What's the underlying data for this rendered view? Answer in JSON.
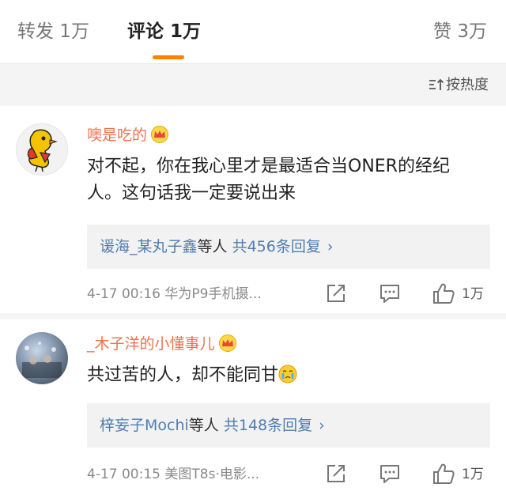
{
  "tabs": {
    "repost": "转发 1万",
    "comment": "评论 1万",
    "like": "赞 3万"
  },
  "sort": {
    "label": "按热度"
  },
  "comments": [
    {
      "username": "噢是吃的",
      "text": "对不起，你在我心里才是最适合当ONER的经纪人。这句话我一定要说出来",
      "replies": {
        "users": "谖海_某丸子鑫",
        "suffix": "等人",
        "count": "共456条回复"
      },
      "time": "4-17 00:16",
      "device": "华为P9手机摄...",
      "likes": "1万"
    },
    {
      "username": "_木子洋的小懂事儿",
      "text": "共过苦的人，却不能同甘",
      "replies": {
        "users": "梓妄子Mochi",
        "suffix": "等人",
        "count": "共148条回复"
      },
      "time": "4-17 00:15",
      "device": "美图T8s·电影...",
      "likes": "1万"
    }
  ],
  "colors": {
    "accent": "#ff8200",
    "username": "#eb7350",
    "link": "#507daf"
  },
  "icons": [
    "crown-icon",
    "sort-icon",
    "share-icon",
    "reply-icon",
    "like-icon",
    "crying-emoji-icon",
    "chevron-right-icon"
  ]
}
